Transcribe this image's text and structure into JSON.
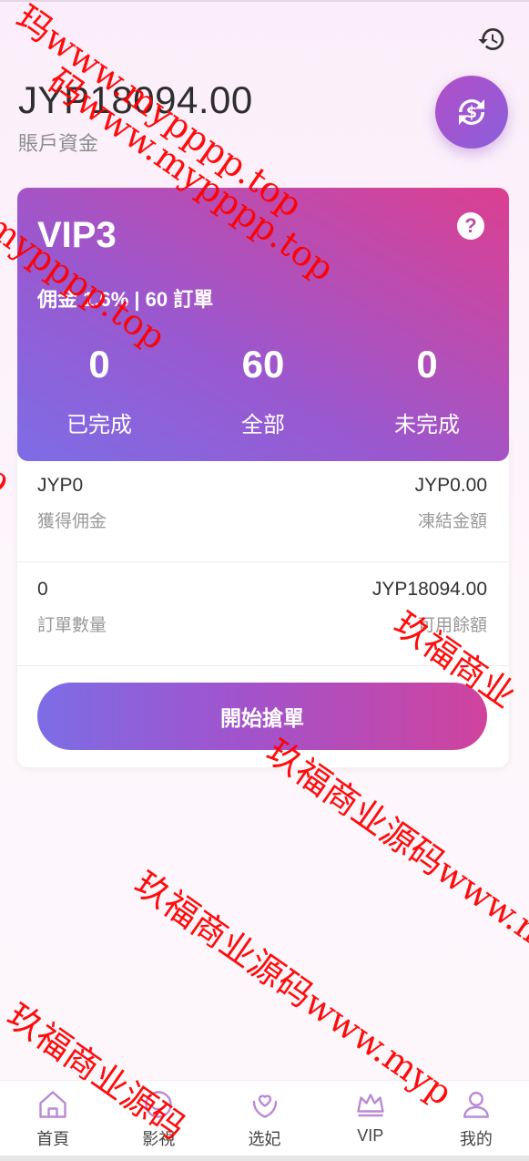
{
  "header": {
    "balance": "JYP18094.00",
    "balance_label": "賬戶資金",
    "history_icon": "history-icon",
    "exchange_icon": "exchange-icon"
  },
  "vip": {
    "title": "VIP3",
    "subtitle": "佣金 1.6% | 60 訂單",
    "stats": [
      {
        "value": "0",
        "label": "已完成"
      },
      {
        "value": "60",
        "label": "全部"
      },
      {
        "value": "0",
        "label": "未完成"
      }
    ]
  },
  "info": {
    "rows": [
      {
        "left_value": "JYP0",
        "left_label": "獲得佣金",
        "right_value": "JYP0.00",
        "right_label": "凍結金額"
      },
      {
        "left_value": "0",
        "left_label": "訂單數量",
        "right_value": "JYP18094.00",
        "right_label": "可用餘額"
      }
    ],
    "start_button": "開始搶單"
  },
  "tabbar": {
    "items": [
      {
        "label": "首頁",
        "icon": "home-icon"
      },
      {
        "label": "影視",
        "icon": "smile-icon"
      },
      {
        "label": "选妃",
        "icon": "heart-hands-icon"
      },
      {
        "label": "VIP",
        "icon": "vip-icon"
      },
      {
        "label": "我的",
        "icon": "user-icon"
      }
    ]
  },
  "watermarks": [
    "玛www.mypppp.top",
    "码www.mypppp.top",
    "mypppp.top",
    "p",
    "玖福商业",
    "玖福商业源码www.m",
    "玖福商业源码www.myp",
    "玖福商业源码"
  ],
  "colors": {
    "accent_start": "#7d6de6",
    "accent_end": "#dc3f90",
    "watermark": "#ff0000"
  }
}
